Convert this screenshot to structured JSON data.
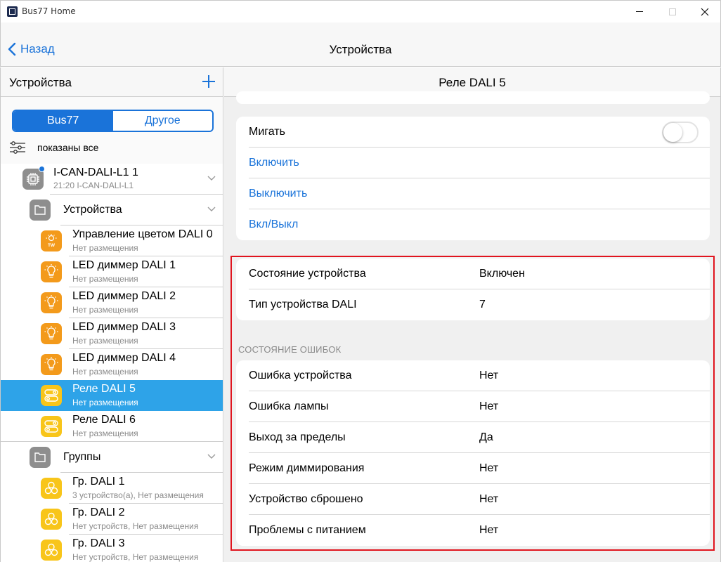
{
  "window": {
    "title": "Bus77 Home"
  },
  "navbar": {
    "back_label": "Назад",
    "title": "Устройства"
  },
  "sidebar": {
    "title": "Устройства",
    "segments": {
      "bus77": "Bus77",
      "other": "Другое"
    },
    "filter_label": "показаны все",
    "tree": [
      {
        "title": "I-CAN-DALI-L1 1",
        "subtitle": "21:20 I-CAN-DALI-L1"
      },
      {
        "title": "Устройства"
      },
      {
        "title": "Управление цветом DALI 0",
        "subtitle": "Нет размещения"
      },
      {
        "title": "LED диммер DALI 1",
        "subtitle": "Нет размещения"
      },
      {
        "title": "LED диммер DALI 2",
        "subtitle": "Нет размещения"
      },
      {
        "title": "LED диммер DALI 3",
        "subtitle": "Нет размещения"
      },
      {
        "title": "LED диммер DALI 4",
        "subtitle": "Нет размещения"
      },
      {
        "title": "Реле DALI 5",
        "subtitle": "Нет размещения"
      },
      {
        "title": "Реле DALI 6",
        "subtitle": "Нет размещения"
      },
      {
        "title": "Группы"
      },
      {
        "title": "Гр. DALI 1",
        "subtitle": "3 устройство(а), Нет размещения"
      },
      {
        "title": "Гр. DALI 2",
        "subtitle": "Нет устройств, Нет размещения"
      },
      {
        "title": "Гр. DALI 3",
        "subtitle": "Нет устройств, Нет размещения"
      }
    ],
    "tw_badge": "TW"
  },
  "main": {
    "title": "Реле DALI 5",
    "actions": {
      "blink_label": "Мигать",
      "on_label": "Включить",
      "off_label": "Выключить",
      "toggle_label": "Вкл/Выкл"
    },
    "state": [
      {
        "label": "Состояние устройства",
        "value": "Включен"
      },
      {
        "label": "Тип устройства DALI",
        "value": "7"
      }
    ],
    "errors_title": "СОСТОЯНИЕ ОШИБОК",
    "errors": [
      {
        "label": "Ошибка устройства",
        "value": "Нет"
      },
      {
        "label": "Ошибка лампы",
        "value": "Нет"
      },
      {
        "label": "Выход за пределы",
        "value": "Да"
      },
      {
        "label": "Режим диммирования",
        "value": "Нет"
      },
      {
        "label": "Устройство сброшено",
        "value": "Нет"
      },
      {
        "label": "Проблемы с питанием",
        "value": "Нет"
      }
    ]
  },
  "colors": {
    "accent": "#1a73d9",
    "selected": "#2ea3e8",
    "highlight": "#e0141e",
    "orange": "#f39a1b",
    "yellow": "#f8c51a"
  }
}
